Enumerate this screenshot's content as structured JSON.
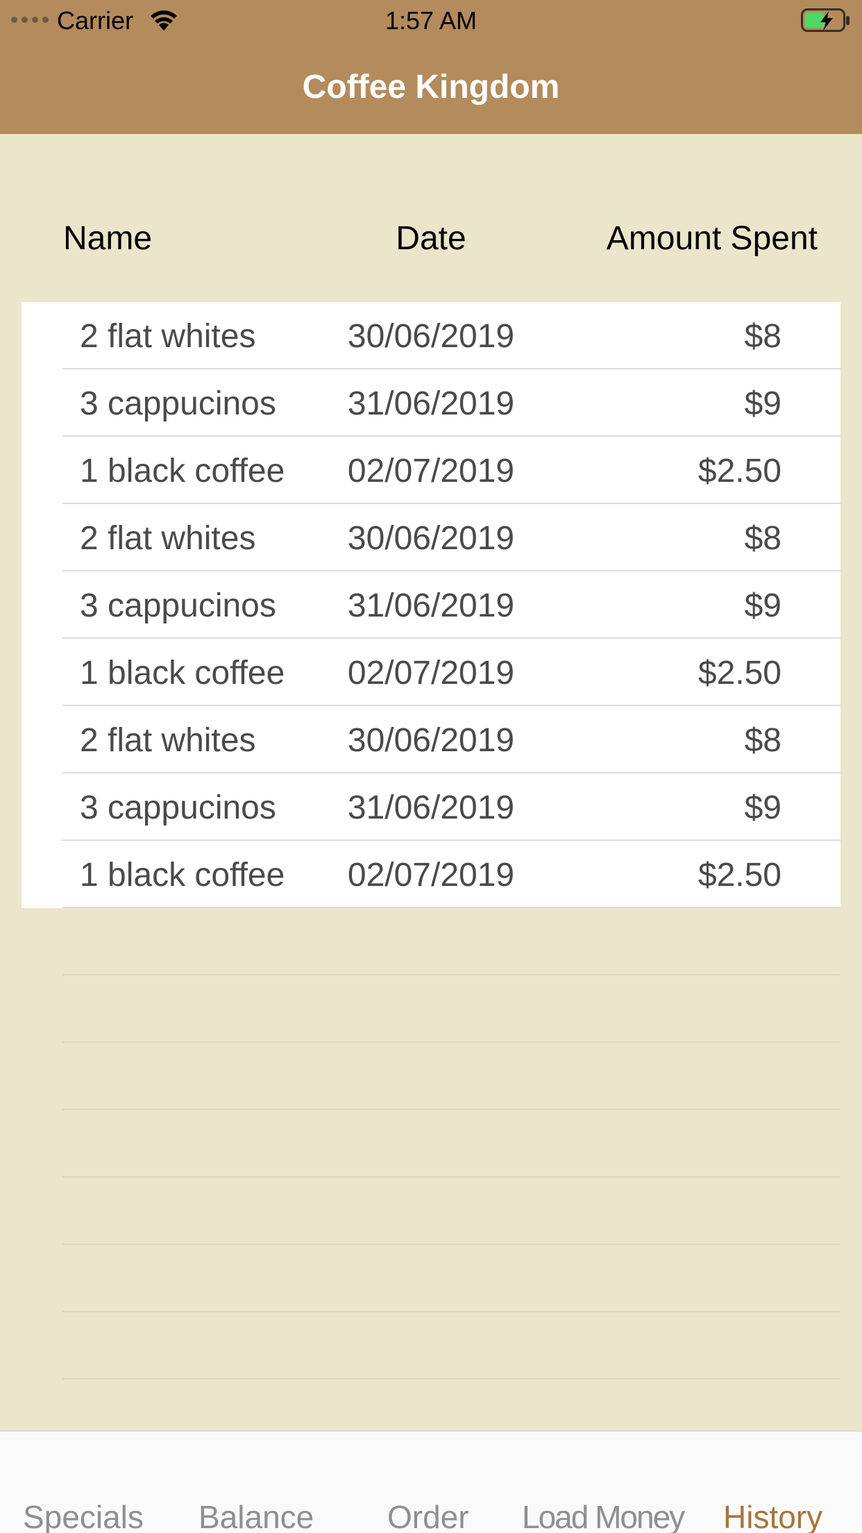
{
  "status_bar": {
    "carrier": "Carrier",
    "time": "1:57 AM"
  },
  "nav": {
    "title": "Coffee Kingdom"
  },
  "table": {
    "headers": {
      "name": "Name",
      "date": "Date",
      "amount": "Amount Spent"
    },
    "rows": [
      {
        "name": "2 flat whites",
        "date": "30/06/2019",
        "amount": "$8"
      },
      {
        "name": "3 cappucinos",
        "date": "31/06/2019",
        "amount": "$9"
      },
      {
        "name": "1 black coffee",
        "date": "02/07/2019",
        "amount": "$2.50"
      },
      {
        "name": "2 flat whites",
        "date": "30/06/2019",
        "amount": "$8"
      },
      {
        "name": "3 cappucinos",
        "date": "31/06/2019",
        "amount": "$9"
      },
      {
        "name": "1 black coffee",
        "date": "02/07/2019",
        "amount": "$2.50"
      },
      {
        "name": "2 flat whites",
        "date": "30/06/2019",
        "amount": "$8"
      },
      {
        "name": "3 cappucinos",
        "date": "31/06/2019",
        "amount": "$9"
      },
      {
        "name": "1 black coffee",
        "date": "02/07/2019",
        "amount": "$2.50"
      }
    ]
  },
  "tabbar": {
    "tabs": [
      {
        "label": "Specials",
        "active": false
      },
      {
        "label": "Balance",
        "active": false
      },
      {
        "label": "Order",
        "active": false
      },
      {
        "label": "Load Money",
        "active": false
      },
      {
        "label": "History",
        "active": true
      }
    ]
  },
  "colors": {
    "nav_background": "#b38b5c",
    "page_background": "#ebe6cb",
    "active_tab": "#a8753a",
    "inactive_tab": "#8e8e93",
    "battery_fill": "#4cd964"
  }
}
